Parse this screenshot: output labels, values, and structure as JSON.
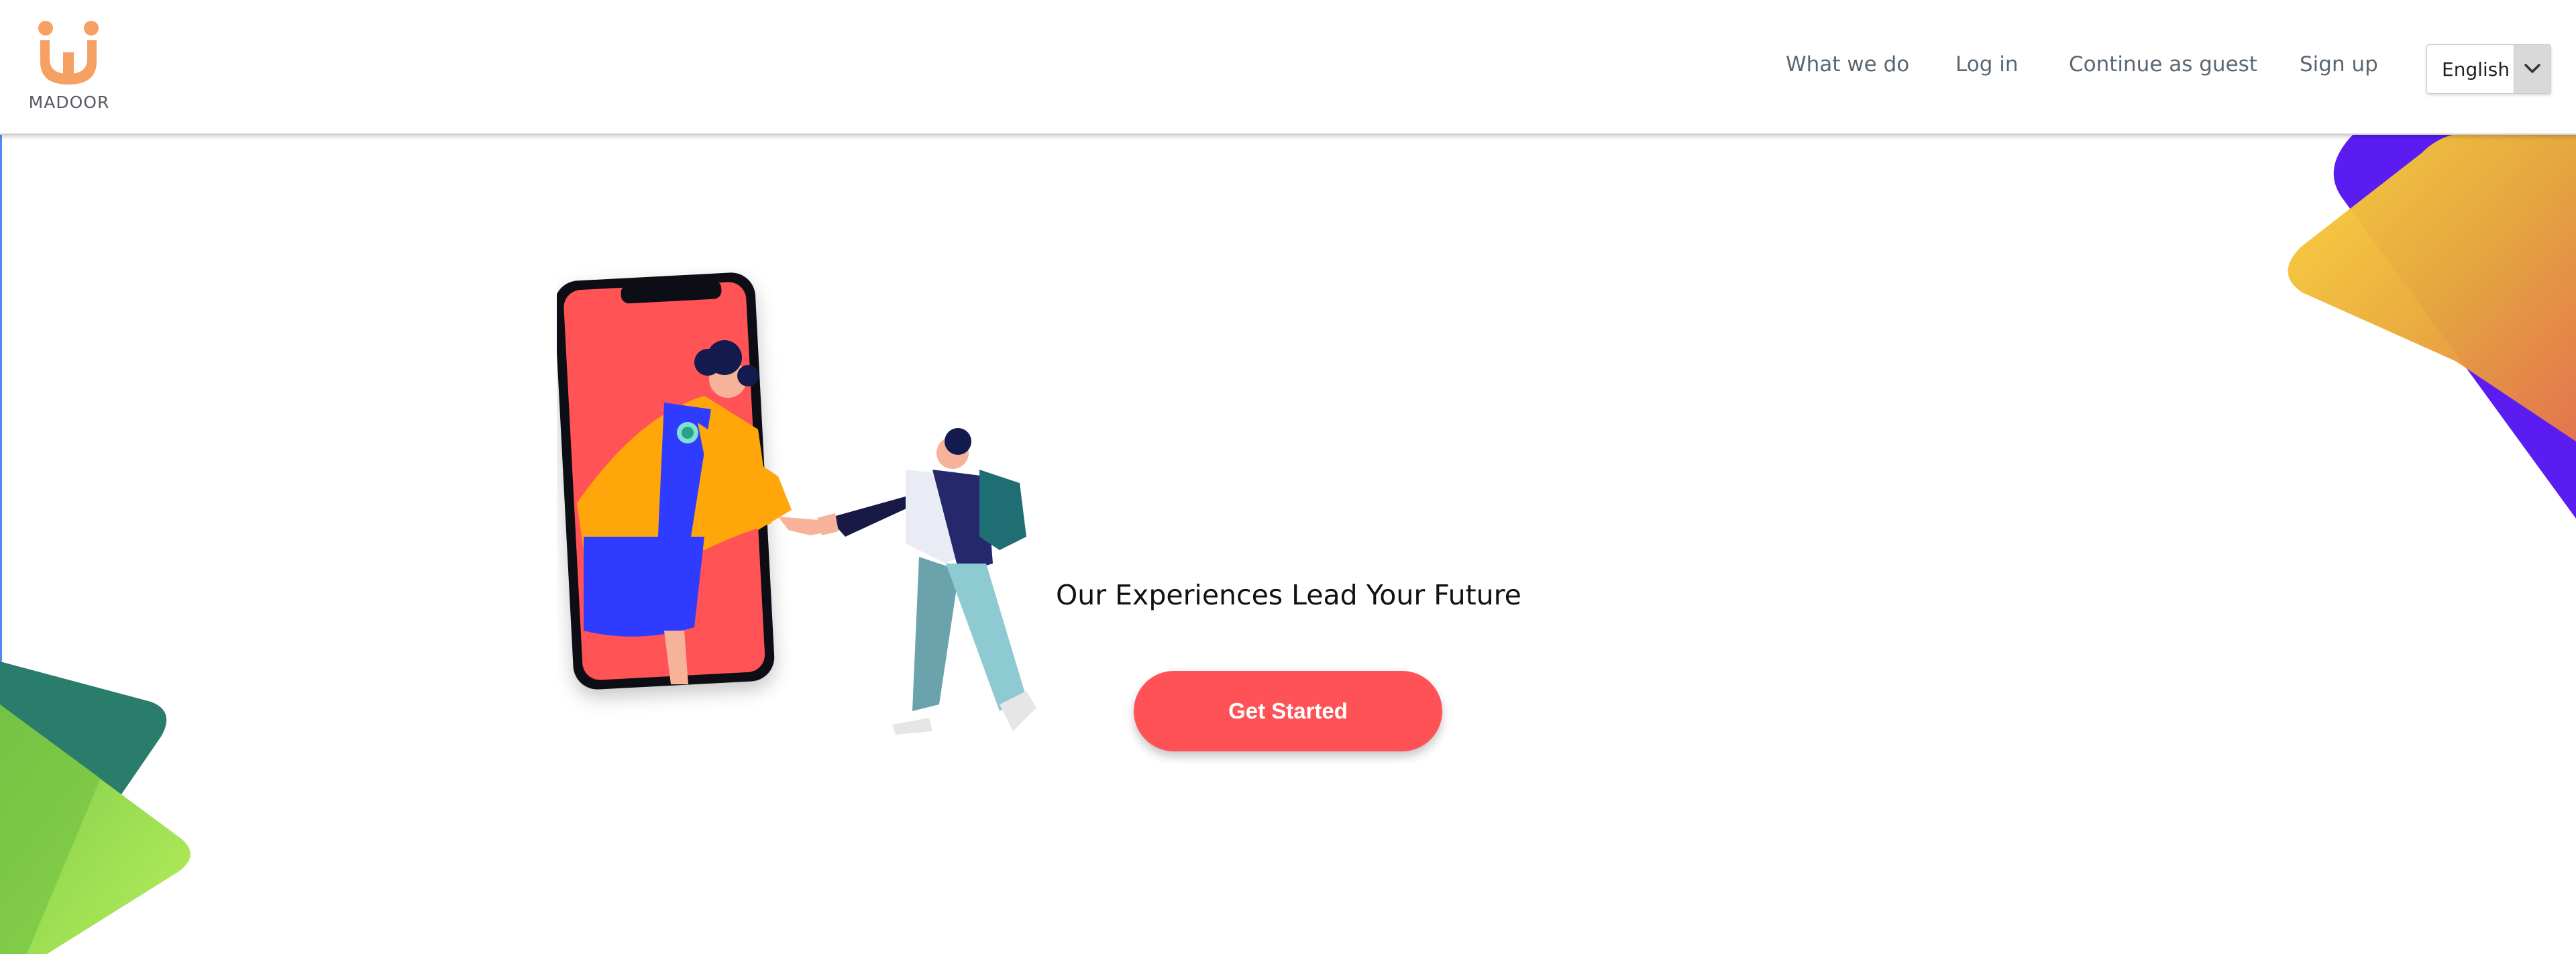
{
  "brand": {
    "name": "MADOOR",
    "logo_icon": "smile-m-logo-icon",
    "logo_color": "#f7a063"
  },
  "nav": {
    "links": [
      {
        "label": "What we do"
      },
      {
        "label": "Log in"
      },
      {
        "label": "Continue as guest"
      },
      {
        "label": "Sign up"
      }
    ],
    "language": {
      "selected": "English",
      "icon": "chevron-down-icon"
    }
  },
  "hero": {
    "tagline": "Our Experiences Lead Your Future",
    "cta_label": "Get Started",
    "illustration": "phone-handshake-illustration"
  },
  "colors": {
    "accent": "#ff5257",
    "deco_yellow": "#f7c83a",
    "deco_orange": "#f0903a",
    "deco_purple": "#5a1cf0",
    "deco_green": "#9ad94a",
    "deco_teal": "#2a7d6a"
  }
}
